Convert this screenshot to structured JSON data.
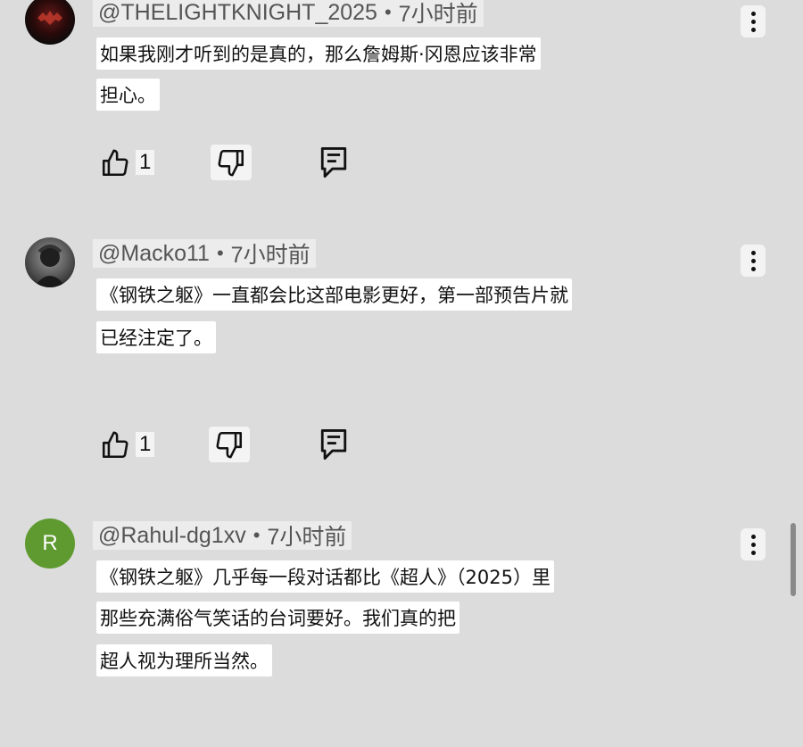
{
  "comments": [
    {
      "author": "@THELIGHTKNIGHT_2025",
      "separator": "•",
      "time": "7小时前",
      "avatar_style": "dark",
      "lines": [
        "如果我刚才听到的是真的，那么詹姆斯·冈恩应该非常",
        "担心。"
      ],
      "likes": "1"
    },
    {
      "author": "@Macko11",
      "separator": "•",
      "time": "7小时前",
      "avatar_style": "photo",
      "lines": [
        "《钢铁之躯》一直都会比这部电影更好，第一部预告片就",
        "已经注定了。"
      ],
      "likes": "1"
    },
    {
      "author": "@Rahul-dg1xv",
      "separator": "•",
      "time": "7小时前",
      "avatar_style": "letter",
      "avatar_letter": "R",
      "lines": [
        "《钢铁之躯》几乎每一段对话都比《超人》（2025）里",
        "那些充满俗气笑话的台词要好。我们真的把",
        "超人视为理所当然。"
      ]
    }
  ],
  "icons": {
    "like": "thumbs-up-icon",
    "dislike": "thumbs-down-icon",
    "reply": "reply-comment-icon",
    "more": "more-options-icon"
  },
  "colors": {
    "background": "#dcdcdc",
    "avatar_letter_bg": "#5e9a2f"
  }
}
